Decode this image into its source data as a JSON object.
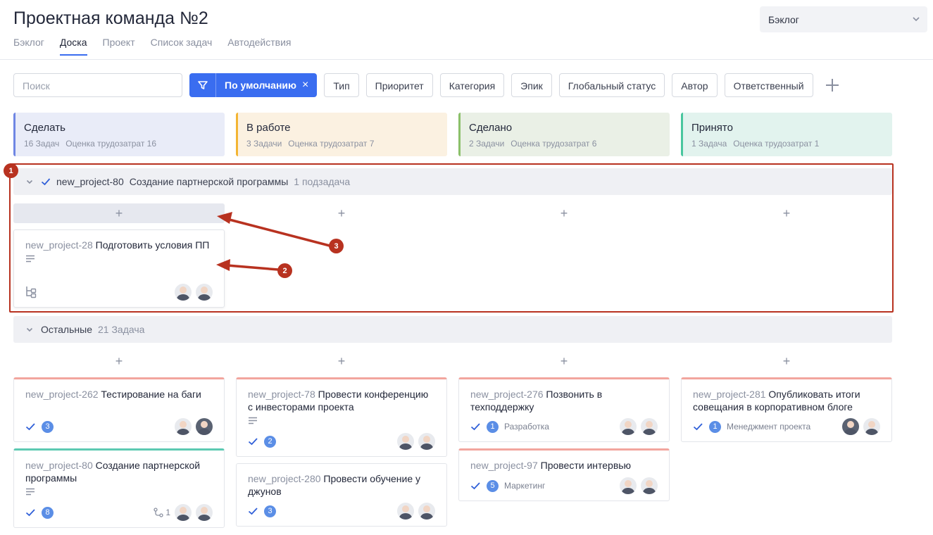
{
  "header": {
    "title": "Проектная команда №2",
    "tabs": [
      "Бэклог",
      "Доска",
      "Проект",
      "Список задач",
      "Автодействия"
    ],
    "active_tab": "Доска",
    "view_select": "Бэклог"
  },
  "filters": {
    "search_placeholder": "Поиск",
    "preset_label": "По умолчанию",
    "preset_clear": "×",
    "buttons": [
      "Тип",
      "Приоритет",
      "Категория",
      "Эпик",
      "Глобальный статус",
      "Автор",
      "Ответственный"
    ]
  },
  "columns": [
    {
      "name": "Сделать",
      "tasks": "16 Задач",
      "estimate": "Оценка трудозатрат 16",
      "color": "#e9ecf8",
      "accent": "#6f86e3"
    },
    {
      "name": "В работе",
      "tasks": "3 Задачи",
      "estimate": "Оценка трудозатрат 7",
      "color": "#fbf1e1",
      "accent": "#f3b533"
    },
    {
      "name": "Сделано",
      "tasks": "2 Задачи",
      "estimate": "Оценка трудозатрат 6",
      "color": "#eaf0e6",
      "accent": "#8bc06a"
    },
    {
      "name": "Принято",
      "tasks": "1 Задача",
      "estimate": "Оценка трудозатрат 1",
      "color": "#e2f3ee",
      "accent": "#49c69e"
    }
  ],
  "groups": {
    "first": {
      "key": "new_project-80",
      "name": "Создание партнерской программы",
      "count": "1 подзадача"
    },
    "rest": {
      "name": "Остальные",
      "count": "21 Задача"
    }
  },
  "add_symbol": "+",
  "cards": {
    "sub": {
      "key": "new_project-28",
      "title": "Подготовить условия ПП"
    },
    "c262": {
      "key": "new_project-262",
      "title": "Тестирование на баги",
      "count": "3"
    },
    "c80": {
      "key": "new_project-80",
      "title": "Создание партнерской программы",
      "count": "8",
      "subtasks": "1"
    },
    "c78": {
      "key": "new_project-78",
      "title": "Провести конференцию с инвесторами проекта",
      "count": "2"
    },
    "c280": {
      "key": "new_project-280",
      "title": "Провести обучение у джунов",
      "count": "3"
    },
    "c276": {
      "key": "new_project-276",
      "title": "Позвонить в техподдержку",
      "count": "1",
      "label": "Разработка"
    },
    "c97": {
      "key": "new_project-97",
      "title": "Провести интервью",
      "count": "5",
      "label": "Маркетинг"
    },
    "c281": {
      "key": "new_project-281",
      "title": "Опубликовать итоги совещания в корпоративном блоге",
      "count": "1",
      "label": "Менеджмент проекта"
    }
  },
  "annotations": {
    "marker1": "1",
    "marker2": "2",
    "marker3": "3",
    "color": "#b83220"
  },
  "icons": [
    "chevron-down-icon",
    "filter-icon",
    "check-icon",
    "description-icon",
    "subtask-tree-icon",
    "subtask-link-icon",
    "plus-icon"
  ]
}
